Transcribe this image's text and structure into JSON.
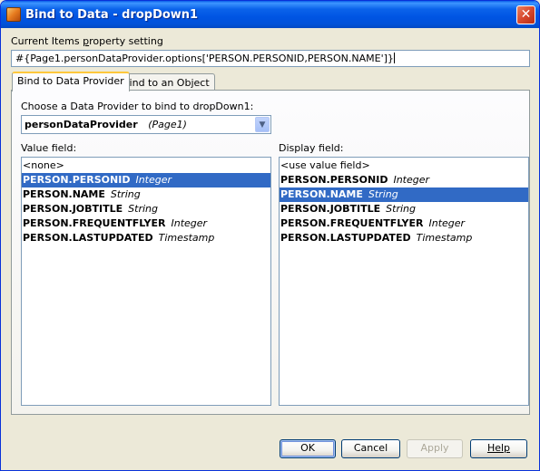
{
  "window": {
    "title": "Bind to Data - dropDown1",
    "close_glyph": "✕"
  },
  "property": {
    "label_pre": "Current Items ",
    "label_accel": "p",
    "label_post": "roperty setting",
    "value": "#{Page1.personDataProvider.options['PERSON.PERSONID,PERSON.NAME']}"
  },
  "tabs": [
    {
      "label": "Bind to Data Provider",
      "active": true
    },
    {
      "label": "Bind to an Object",
      "active": false
    }
  ],
  "provider": {
    "label": "Choose a Data Provider to bind to dropDown1:",
    "selected_name": "personDataProvider",
    "selected_page": "(Page1)",
    "arrow_glyph": "▼"
  },
  "value_field": {
    "label": "Value field:",
    "items": [
      {
        "name": "<none>",
        "type": "",
        "selected": false,
        "plain": true
      },
      {
        "name": "PERSON.PERSONID",
        "type": "Integer",
        "selected": true
      },
      {
        "name": "PERSON.NAME",
        "type": "String",
        "selected": false
      },
      {
        "name": "PERSON.JOBTITLE",
        "type": "String",
        "selected": false
      },
      {
        "name": "PERSON.FREQUENTFLYER",
        "type": "Integer",
        "selected": false
      },
      {
        "name": "PERSON.LASTUPDATED",
        "type": "Timestamp",
        "selected": false
      }
    ]
  },
  "display_field": {
    "label": "Display field:",
    "items": [
      {
        "name": "<use value field>",
        "type": "",
        "selected": false,
        "plain": true
      },
      {
        "name": "PERSON.PERSONID",
        "type": "Integer",
        "selected": false
      },
      {
        "name": "PERSON.NAME",
        "type": "String",
        "selected": true
      },
      {
        "name": "PERSON.JOBTITLE",
        "type": "String",
        "selected": false
      },
      {
        "name": "PERSON.FREQUENTFLYER",
        "type": "Integer",
        "selected": false
      },
      {
        "name": "PERSON.LASTUPDATED",
        "type": "Timestamp",
        "selected": false
      }
    ]
  },
  "buttons": {
    "ok": "OK",
    "cancel": "Cancel",
    "apply": "Apply",
    "help": "Help"
  },
  "colors": {
    "selection": "#316ac5",
    "titlebar": "#0054e3",
    "dialog_bg": "#ece9d8"
  }
}
